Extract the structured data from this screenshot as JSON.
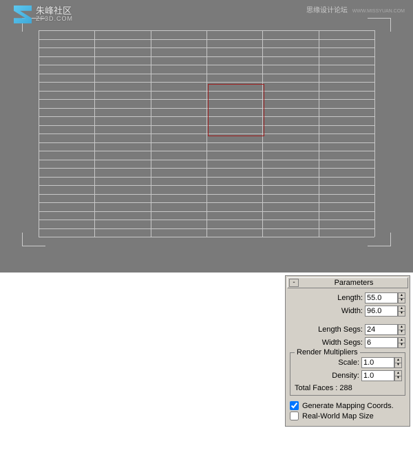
{
  "watermark": {
    "title": "朱峰社区",
    "subtitle": "ZF3D.COM",
    "forum": "思缘设计论坛",
    "forum_url": "WWW.MISSYUAN.COM"
  },
  "grid": {
    "rows": 24,
    "cols": 6
  },
  "panel": {
    "header": "Parameters",
    "collapse": "-",
    "length_label": "Length:",
    "length_value": "55.0",
    "width_label": "Width:",
    "width_value": "96.0",
    "lengthsegs_label": "Length Segs:",
    "lengthsegs_value": "24",
    "widthsegs_label": "Width Segs:",
    "widthsegs_value": "6",
    "render_mult_legend": "Render Multipliers",
    "scale_label": "Scale:",
    "scale_value": "1.0",
    "density_label": "Density:",
    "density_value": "1.0",
    "totalfaces_label": "Total Faces : 288",
    "gen_mapping": "Generate Mapping Coords.",
    "realworld": "Real-World Map Size"
  }
}
